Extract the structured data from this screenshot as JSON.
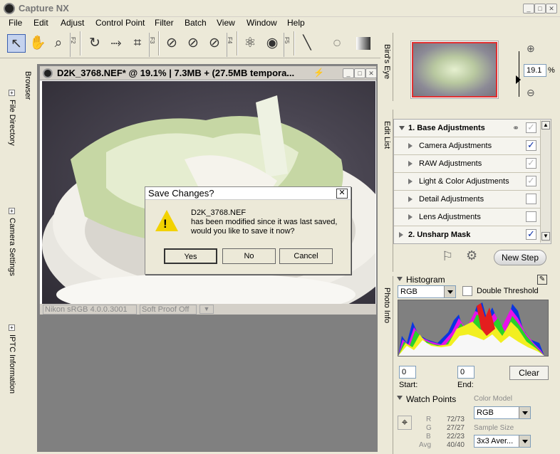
{
  "app": {
    "title": "Capture NX"
  },
  "menu": [
    "File",
    "Edit",
    "Adjust",
    "Control Point",
    "Filter",
    "Batch",
    "View",
    "Window",
    "Help"
  ],
  "toolbar": {
    "fkeys": [
      "F2",
      "F3",
      "F4",
      "F5"
    ]
  },
  "left_panels": [
    "Browser",
    "File Directory",
    "Camera Settings",
    "IPTC Information"
  ],
  "document": {
    "title": "D2K_3768.NEF*  @ 19.1%  |  7.3MB + (27.5MB tempora...",
    "profile": "Nikon sRGB 4.0.0.3001",
    "proof": "Soft Proof Off"
  },
  "dialog": {
    "title": "Save Changes?",
    "filename": "D2K_3768.NEF",
    "line2": "has been modified since it was last saved,",
    "line3": "would you like to save it now?",
    "buttons": {
      "yes": "Yes",
      "no": "No",
      "cancel": "Cancel"
    }
  },
  "right_strips": [
    "Bird's Eye",
    "Edit List",
    "Photo Info"
  ],
  "birdseye": {
    "zoom": "19.1",
    "unit": "%"
  },
  "editlist": {
    "base": {
      "label": "1. Base Adjustments",
      "checked": true
    },
    "items": [
      {
        "label": "Camera Adjustments",
        "mark": "✓"
      },
      {
        "label": "RAW Adjustments",
        "mark": "✓"
      },
      {
        "label": "Light & Color Adjustments",
        "mark": "✓"
      },
      {
        "label": "Detail Adjustments",
        "mark": ""
      },
      {
        "label": "Lens Adjustments",
        "mark": ""
      }
    ],
    "unsharp": {
      "label": "2. Unsharp Mask",
      "mark": "✓"
    },
    "new_step": "New Step"
  },
  "histogram": {
    "title": "Histogram",
    "channel": "RGB",
    "double_threshold": "Double Threshold",
    "start_value": "0",
    "end_value": "0",
    "start_label": "Start:",
    "end_label": "End:",
    "clear": "Clear"
  },
  "watch": {
    "title": "Watch Points",
    "color_model_label": "Color Model",
    "color_model": "RGB",
    "sample_size_label": "Sample Size",
    "sample_size": "3x3 Aver...",
    "rows": [
      {
        "label": "R",
        "value": "72/73"
      },
      {
        "label": "G",
        "value": "27/27"
      },
      {
        "label": "B",
        "value": "22/23"
      },
      {
        "label": "Avg",
        "value": "40/40"
      }
    ]
  },
  "colors": {
    "accent": "#0a2ea5",
    "selection": "#e13030",
    "dialog_warning": "#f2d200"
  }
}
